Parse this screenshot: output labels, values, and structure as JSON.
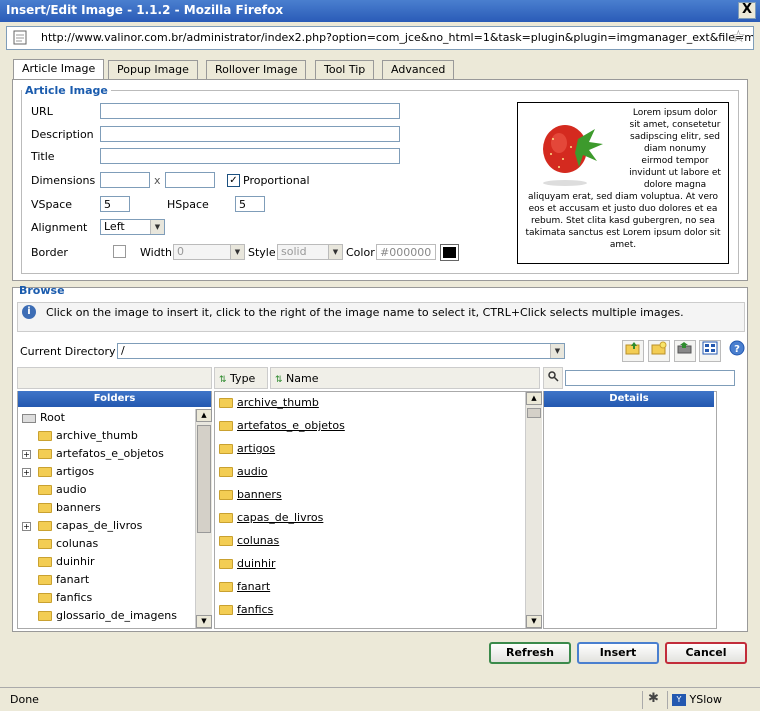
{
  "window": {
    "title": "Insert/Edit Image - 1.1.2 - Mozilla Firefox",
    "close": "X",
    "url": "http://www.valinor.com.br/administrator/index2.php?option=com_jce&no_html=1&task=plugin&plugin=imgmanager_ext&file=manager.php"
  },
  "tabs": [
    "Article Image",
    "Popup Image",
    "Rollover Image",
    "Tool Tip",
    "Advanced"
  ],
  "article": {
    "legend": "Article Image",
    "url_label": "URL",
    "description_label": "Description",
    "title_label": "Title",
    "dimensions_label": "Dimensions",
    "times": "x",
    "proportional_label": "Proportional",
    "proportional_checked": true,
    "vspace_label": "VSpace",
    "vspace_value": "5",
    "hspace_label": "HSpace",
    "hspace_value": "5",
    "alignment_label": "Alignment",
    "alignment_value": "Left",
    "border_label": "Border",
    "width_label": "Width",
    "width_value": "0",
    "style_label": "Style",
    "style_value": "solid",
    "color_label": "Color",
    "color_value": "#000000",
    "swatch_color": "#000000",
    "preview_text_top": "Lorem ipsum dolor sit amet, consetetur sadipscing elitr, sed diam nonumy eirmod tempor invidunt ut labore et dolore magna",
    "preview_text_bottom": "aliquyam erat, sed diam voluptua. At vero eos et accusam et justo duo dolores et ea rebum. Stet clita kasd gubergren, no sea takimata sanctus est Lorem ipsum dolor sit amet."
  },
  "browse": {
    "legend": "Browse",
    "info": "Click on the image to insert it, click to the right of the image name to select it, CTRL+Click selects multiple images.",
    "current_dir_label": "Current Directory",
    "current_dir_value": "/",
    "type_header": "Type",
    "name_header": "Name",
    "folders_header": "Folders",
    "details_header": "Details",
    "tree": [
      {
        "label": "Root",
        "expandable": false,
        "root": true
      },
      {
        "label": "archive_thumb",
        "expandable": false
      },
      {
        "label": "artefatos_e_objetos",
        "expandable": true
      },
      {
        "label": "artigos",
        "expandable": true
      },
      {
        "label": "audio",
        "expandable": false
      },
      {
        "label": "banners",
        "expandable": false
      },
      {
        "label": "capas_de_livros",
        "expandable": true
      },
      {
        "label": "colunas",
        "expandable": false
      },
      {
        "label": "duinhir",
        "expandable": false
      },
      {
        "label": "fanart",
        "expandable": false
      },
      {
        "label": "fanfics",
        "expandable": false
      },
      {
        "label": "glossario_de_imagens",
        "expandable": false
      }
    ],
    "files": [
      "archive_thumb",
      "artefatos_e_objetos",
      "artigos",
      "audio",
      "banners",
      "capas_de_livros",
      "colunas",
      "duinhir",
      "fanart",
      "fanfics"
    ]
  },
  "buttons": {
    "refresh": "Refresh",
    "insert": "Insert",
    "cancel": "Cancel"
  },
  "status": {
    "text": "Done",
    "yslow": "YSlow"
  },
  "icons": [
    "folder-up-icon",
    "new-folder-icon",
    "upload-icon",
    "view-icon",
    "help-icon",
    "search-icon",
    "info-icon"
  ]
}
